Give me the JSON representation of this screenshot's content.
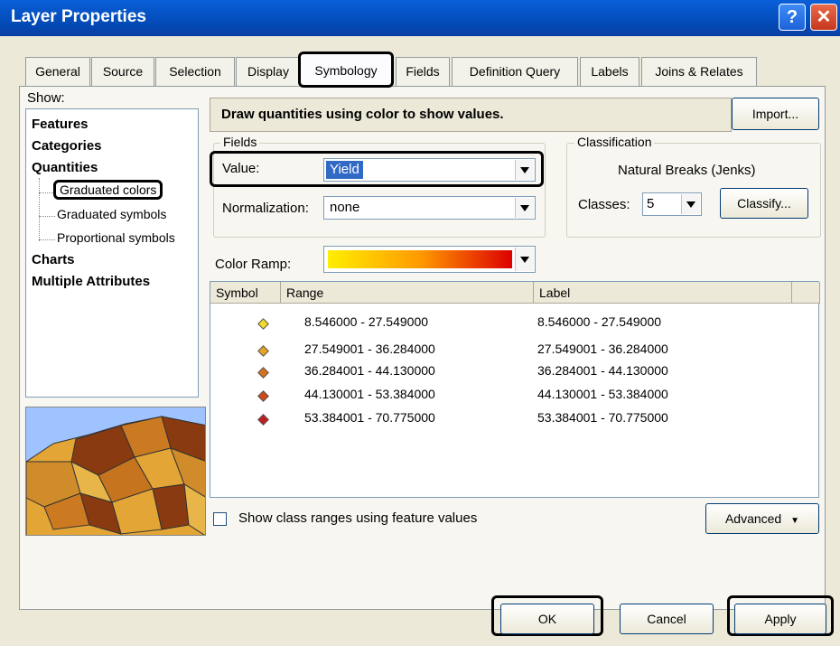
{
  "window": {
    "title": "Layer Properties",
    "help_glyph": "?",
    "close_glyph": "✕"
  },
  "tabs": [
    "General",
    "Source",
    "Selection",
    "Display",
    "Symbology",
    "Fields",
    "Definition Query",
    "Labels",
    "Joins & Relates"
  ],
  "active_tab": "Symbology",
  "show": {
    "label": "Show:",
    "categories": [
      "Features",
      "Categories",
      "Quantities"
    ],
    "quantities_items": [
      "Graduated colors",
      "Graduated symbols",
      "Proportional symbols"
    ],
    "selected_item": "Graduated colors",
    "after": [
      "Charts",
      "Multiple Attributes"
    ]
  },
  "description": "Draw quantities using color to show values.",
  "import_label": "Import...",
  "fields": {
    "legend": "Fields",
    "value_label": "Value:",
    "value": "Yield",
    "normalization_label": "Normalization:",
    "normalization": "none"
  },
  "classification": {
    "legend": "Classification",
    "method": "Natural Breaks (Jenks)",
    "classes_label": "Classes:",
    "classes": "5",
    "classify_label": "Classify..."
  },
  "color_ramp": {
    "label": "Color Ramp:",
    "from": "#ffee00",
    "to": "#dd0000"
  },
  "table": {
    "headers": [
      "Symbol",
      "Range",
      "Label"
    ],
    "rows": [
      {
        "color": "#f2dc2a",
        "range": "8.546000 - 27.549000",
        "label": "8.546000 - 27.549000"
      },
      {
        "color": "#e8a324",
        "range": "27.549001 - 36.284000",
        "label": "27.549001 - 36.284000"
      },
      {
        "color": "#d8721f",
        "range": "36.284001 - 44.130000",
        "label": "36.284001 - 44.130000"
      },
      {
        "color": "#cc4a1c",
        "range": "44.130001 - 53.384000",
        "label": "44.130001 - 53.384000"
      },
      {
        "color": "#bf1e1e",
        "range": "53.384001 - 70.775000",
        "label": "53.384001 - 70.775000"
      }
    ]
  },
  "show_class_ranges_label": "Show class ranges using feature values",
  "advanced_label": "Advanced",
  "buttons": {
    "ok": "OK",
    "cancel": "Cancel",
    "apply": "Apply"
  }
}
